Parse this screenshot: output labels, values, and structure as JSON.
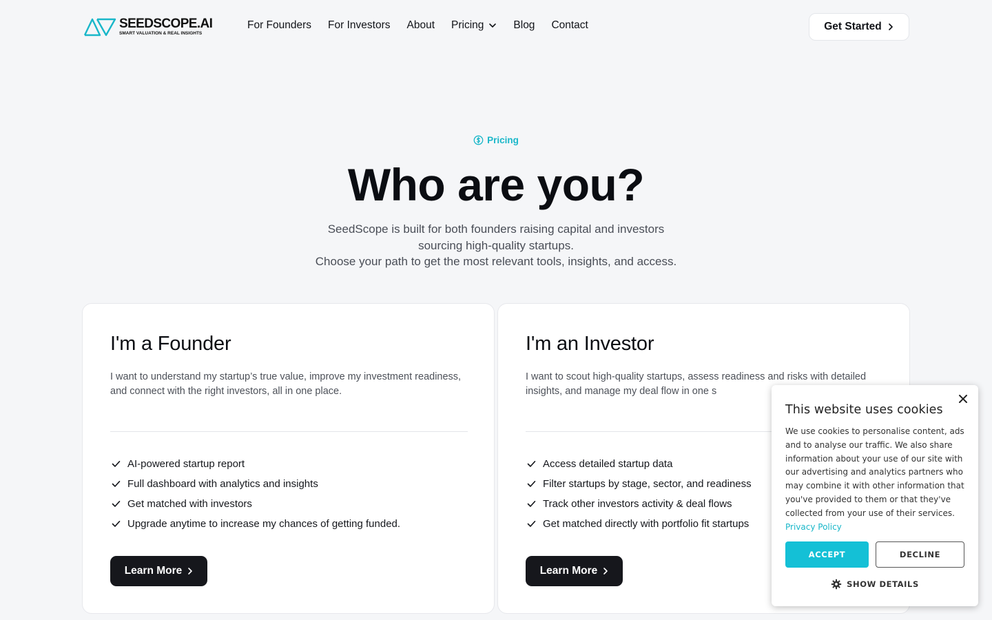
{
  "brand": {
    "name": "SEEDSCOPE.AI",
    "tagline": "SMART VALUATION & REAL INSIGHTS",
    "accent": "#19b7c9"
  },
  "nav": {
    "items": [
      {
        "label": "For Founders"
      },
      {
        "label": "For Investors"
      },
      {
        "label": "About"
      },
      {
        "label": "Pricing",
        "has_dropdown": true
      },
      {
        "label": "Blog"
      },
      {
        "label": "Contact"
      }
    ],
    "cta": "Get Started"
  },
  "hero": {
    "eyebrow": "Pricing",
    "eyebrow_icon": "dollar-circle-icon",
    "title": "Who are you?",
    "subtitle_lines": [
      "SeedScope is built for both founders raising capital and investors",
      "sourcing high-quality startups.",
      "Choose your path to get the most relevant tools, insights, and access."
    ]
  },
  "cards": [
    {
      "title": "I'm a Founder",
      "description": "I want to understand my startup’s true value, improve my investment readiness, and connect with the right investors, all in one place.",
      "features": [
        "AI-powered startup report",
        "Full dashboard with analytics and insights",
        "Get matched with investors",
        "Upgrade anytime to increase my chances of getting funded."
      ],
      "button": "Learn More"
    },
    {
      "title": "I'm an Investor",
      "description": "I want to scout high-quality startups, assess readiness and risks with detailed insights, and manage my deal flow in one s",
      "features": [
        "Access detailed startup data",
        "Filter startups by stage, sector, and readiness",
        "Track other investors activity & deal flows",
        "Get matched directly with portfolio fit startups"
      ],
      "button": "Learn More"
    }
  ],
  "cookie": {
    "title": "This website uses cookies",
    "text": "We use cookies to personalise content, ads and to analyse our traffic. We also share information about your use of our site with our advertising and analytics partners who may combine it with other information that you've provided to them or that they've collected from your use of their services.",
    "link": "Privacy Policy",
    "accept": "ACCEPT",
    "decline": "DECLINE",
    "details": "SHOW DETAILS",
    "accept_color": "#14c0d6"
  }
}
